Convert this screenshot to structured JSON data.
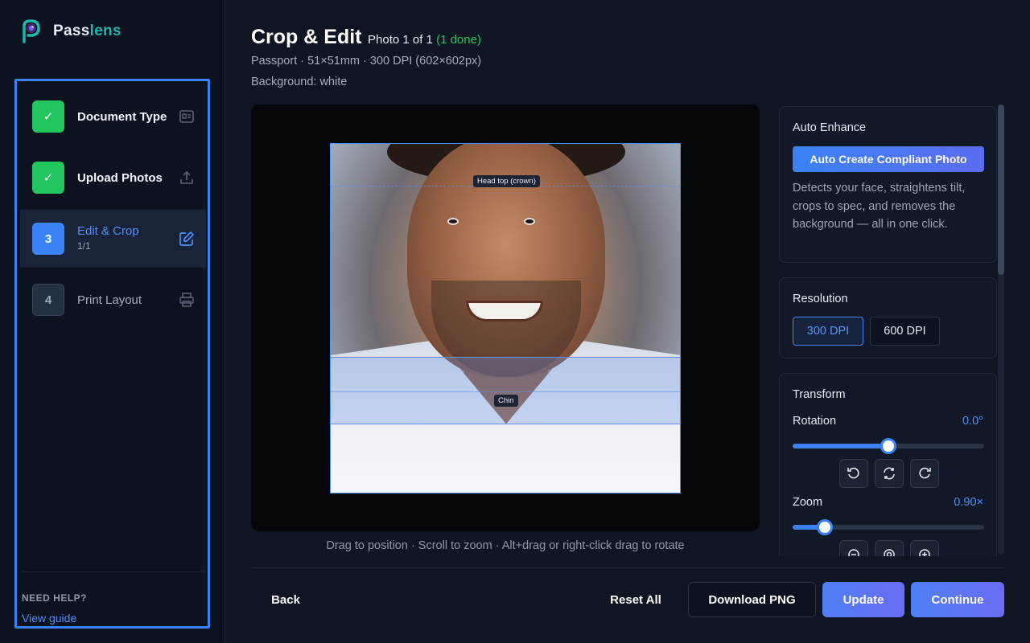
{
  "app": {
    "name_a": "Pass",
    "name_b": "lens"
  },
  "sidebar": {
    "steps": [
      {
        "badge": "✓",
        "label": "Document Type",
        "status": "done",
        "icon": "id-card-icon"
      },
      {
        "badge": "✓",
        "label": "Upload Photos",
        "status": "done",
        "icon": "upload-icon"
      },
      {
        "badge": "3",
        "label": "Edit & Crop",
        "sub": "1/1",
        "status": "current",
        "icon": "edit-icon"
      },
      {
        "badge": "4",
        "label": "Print Layout",
        "status": "todo",
        "icon": "printer-icon"
      }
    ],
    "help_title": "NEED HELP?",
    "help_link": "View guide"
  },
  "header": {
    "title": "Crop & Edit",
    "photo_count": "Photo 1 of 1 ",
    "photo_done": "(1 done)",
    "spec": "Passport · 51×51mm · 300 DPI (602×602px)",
    "background": "Background: white"
  },
  "canvas": {
    "head_top_tag": "Head top (crown)",
    "chin_tag": "Chin",
    "hint": "Drag to position · Scroll to zoom · Alt+drag or right-click drag to rotate"
  },
  "panel": {
    "auto": {
      "title": "Auto Enhance",
      "button": "Auto Create Compliant Photo",
      "desc": "Detects your face, straightens tilt, crops to spec, and removes the background — all in one click."
    },
    "resolution": {
      "title": "Resolution",
      "options": [
        "300 DPI",
        "600 DPI"
      ],
      "selected": "300 DPI"
    },
    "transform": {
      "title": "Transform",
      "rotation_label": "Rotation",
      "rotation_value": "0.0°",
      "rotation_level": 0.5,
      "zoom_label": "Zoom",
      "zoom_value": "0.90×",
      "zoom_level": 0.17
    }
  },
  "footer": {
    "back": "Back",
    "reset": "Reset All",
    "download": "Download PNG",
    "update": "Update",
    "continue": "Continue"
  },
  "colors": {
    "accent": "#3b82f6",
    "success": "#22c55e",
    "brand_teal": "#1fb7ad"
  }
}
